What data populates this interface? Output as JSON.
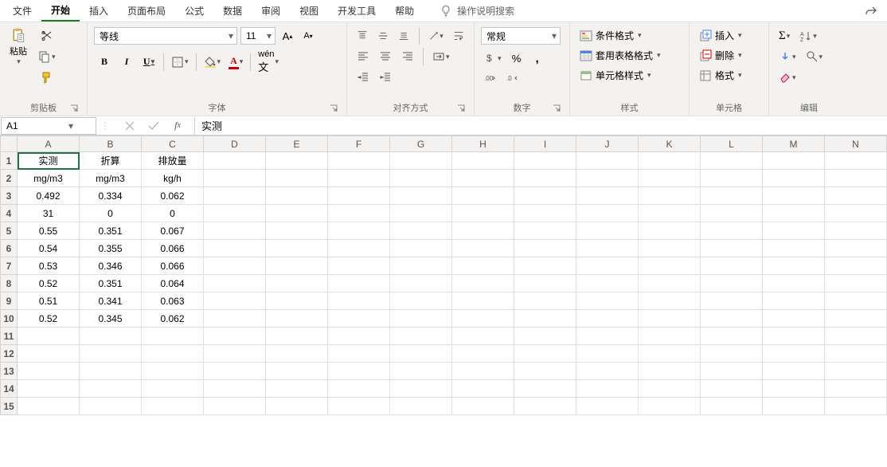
{
  "menu": {
    "items": [
      "文件",
      "开始",
      "插入",
      "页面布局",
      "公式",
      "数据",
      "审阅",
      "视图",
      "开发工具",
      "帮助"
    ],
    "active_index": 1,
    "tell_me": "操作说明搜索"
  },
  "ribbon": {
    "clipboard": {
      "paste": "粘贴",
      "label": "剪贴板"
    },
    "font": {
      "name": "等线",
      "size": "11",
      "label": "字体"
    },
    "alignment": {
      "label": "对齐方式"
    },
    "number": {
      "format": "常规",
      "label": "数字"
    },
    "styles": {
      "cond": "条件格式",
      "table": "套用表格格式",
      "cell": "单元格样式",
      "label": "样式"
    },
    "cells": {
      "insert": "插入",
      "delete": "删除",
      "format": "格式",
      "label": "单元格"
    },
    "editing": {
      "label": "编辑"
    }
  },
  "namebox": "A1",
  "formula": "实测",
  "sheet": {
    "columns": [
      "A",
      "B",
      "C",
      "D",
      "E",
      "F",
      "G",
      "H",
      "I",
      "J",
      "K",
      "L",
      "M",
      "N"
    ],
    "rows": 15,
    "data": [
      [
        "实测",
        "折算",
        "排放量",
        "",
        "",
        "",
        "",
        "",
        "",
        "",
        "",
        "",
        "",
        ""
      ],
      [
        "mg/m3",
        "mg/m3",
        "kg/h",
        "",
        "",
        "",
        "",
        "",
        "",
        "",
        "",
        "",
        "",
        ""
      ],
      [
        "0.492",
        "0.334",
        "0.062",
        "",
        "",
        "",
        "",
        "",
        "",
        "",
        "",
        "",
        "",
        ""
      ],
      [
        "31",
        "0",
        "0",
        "",
        "",
        "",
        "",
        "",
        "",
        "",
        "",
        "",
        "",
        ""
      ],
      [
        "0.55",
        "0.351",
        "0.067",
        "",
        "",
        "",
        "",
        "",
        "",
        "",
        "",
        "",
        "",
        ""
      ],
      [
        "0.54",
        "0.355",
        "0.066",
        "",
        "",
        "",
        "",
        "",
        "",
        "",
        "",
        "",
        "",
        ""
      ],
      [
        "0.53",
        "0.346",
        "0.066",
        "",
        "",
        "",
        "",
        "",
        "",
        "",
        "",
        "",
        "",
        ""
      ],
      [
        "0.52",
        "0.351",
        "0.064",
        "",
        "",
        "",
        "",
        "",
        "",
        "",
        "",
        "",
        "",
        ""
      ],
      [
        "0.51",
        "0.341",
        "0.063",
        "",
        "",
        "",
        "",
        "",
        "",
        "",
        "",
        "",
        "",
        ""
      ],
      [
        "0.52",
        "0.345",
        "0.062",
        "",
        "",
        "",
        "",
        "",
        "",
        "",
        "",
        "",
        "",
        ""
      ],
      [
        "",
        "",
        "",
        "",
        "",
        "",
        "",
        "",
        "",
        "",
        "",
        "",
        "",
        ""
      ],
      [
        "",
        "",
        "",
        "",
        "",
        "",
        "",
        "",
        "",
        "",
        "",
        "",
        "",
        ""
      ],
      [
        "",
        "",
        "",
        "",
        "",
        "",
        "",
        "",
        "",
        "",
        "",
        "",
        "",
        ""
      ],
      [
        "",
        "",
        "",
        "",
        "",
        "",
        "",
        "",
        "",
        "",
        "",
        "",
        "",
        ""
      ],
      [
        "",
        "",
        "",
        "",
        "",
        "",
        "",
        "",
        "",
        "",
        "",
        "",
        "",
        ""
      ]
    ],
    "selected": {
      "row": 0,
      "col": 0
    },
    "page_break_after_col": 8
  }
}
